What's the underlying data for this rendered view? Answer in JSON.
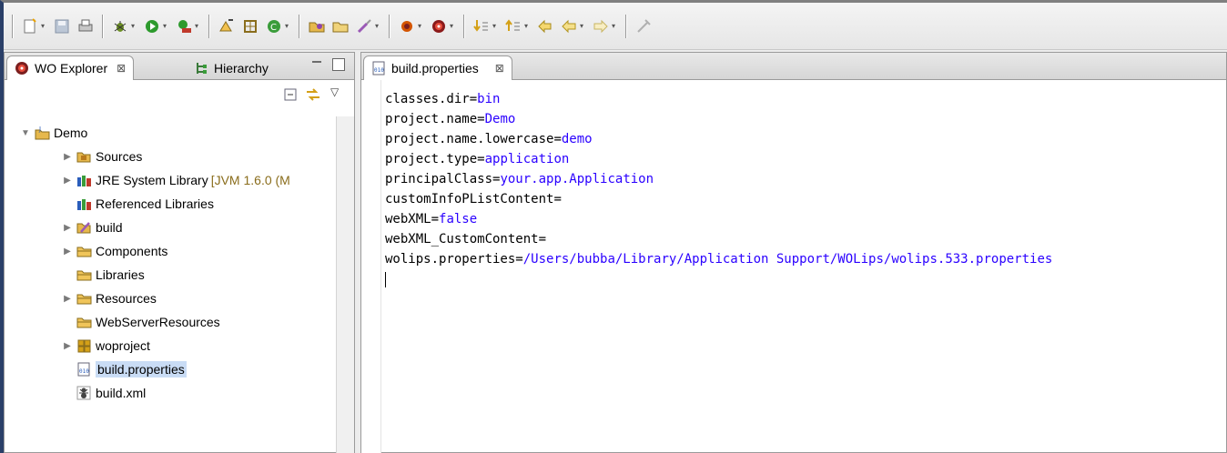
{
  "left_panel": {
    "tabs": [
      {
        "label": "WO Explorer",
        "close": "⊠"
      },
      {
        "label": "Hierarchy"
      }
    ],
    "tree": [
      {
        "label": "Demo",
        "icon": "project-icon",
        "expander": "expanded",
        "level": 0
      },
      {
        "label": "Sources",
        "icon": "source-folder-icon",
        "expander": "collapsed",
        "level": 1
      },
      {
        "label": "JRE System Library",
        "suffix": "[JVM 1.6.0 (M",
        "icon": "library-icon",
        "expander": "collapsed",
        "level": 1
      },
      {
        "label": "Referenced Libraries",
        "icon": "library-icon",
        "expander": "none",
        "level": 1
      },
      {
        "label": "build",
        "icon": "build-folder-icon",
        "expander": "collapsed",
        "level": 1
      },
      {
        "label": "Components",
        "icon": "folder-icon",
        "expander": "collapsed",
        "level": 1
      },
      {
        "label": "Libraries",
        "icon": "folder-icon",
        "expander": "none",
        "level": 1
      },
      {
        "label": "Resources",
        "icon": "folder-icon",
        "expander": "collapsed",
        "level": 1
      },
      {
        "label": "WebServerResources",
        "icon": "folder-icon",
        "expander": "none",
        "level": 1
      },
      {
        "label": "woproject",
        "icon": "package-icon",
        "expander": "collapsed",
        "level": 1
      },
      {
        "label": "build.properties",
        "icon": "properties-file-icon",
        "expander": "none",
        "level": 1,
        "selected": true
      },
      {
        "label": "build.xml",
        "icon": "ant-file-icon",
        "expander": "none",
        "level": 1
      }
    ]
  },
  "editor": {
    "tab_label": "build.properties",
    "tab_close": "⊠",
    "lines": [
      {
        "key": "classes.dir",
        "value": "bin"
      },
      {
        "key": "project.name",
        "value": "Demo"
      },
      {
        "key": "project.name.lowercase",
        "value": "demo"
      },
      {
        "key": "project.type",
        "value": "application"
      },
      {
        "key": "principalClass",
        "value": "your.app.Application"
      },
      {
        "key": "customInfoPListContent",
        "value": ""
      },
      {
        "key": "webXML",
        "value": "false"
      },
      {
        "key": "webXML_CustomContent",
        "value": ""
      },
      {
        "key": "wolips.properties",
        "value": "/Users/bubba/Library/Application Support/WOLips/wolips.533.properties"
      }
    ]
  },
  "colors": {
    "value_text": "#2a00ff",
    "selection": "#c9dcf5",
    "frame": "#2a3f68"
  }
}
